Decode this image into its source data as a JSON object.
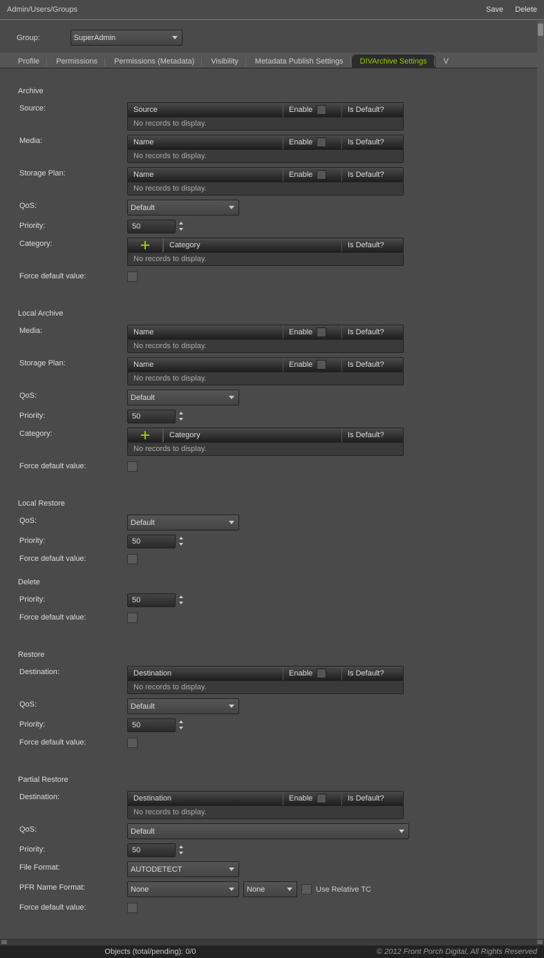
{
  "header": {
    "breadcrumb": "Admin/Users/Groups",
    "save": "Save",
    "delete": "Delete"
  },
  "group": {
    "label": "Group:",
    "value": "SuperAdmin"
  },
  "tabs": [
    "Profile",
    "Permissions",
    "Permissions (Metadata)",
    "Visibility",
    "Metadata Publish Settings",
    "DIVArchive Settings",
    "V"
  ],
  "active_tab": "DIVArchive Settings",
  "common": {
    "enable": "Enable",
    "isdefault": "Is Default?",
    "norec": "No records to display.",
    "qos": "Default",
    "priority": "50",
    "force": "Force default value:",
    "source": "Source",
    "name": "Name",
    "category": "Category",
    "dest": "Destination"
  },
  "sections": {
    "archive": {
      "title": "Archive",
      "l_source": "Source:",
      "l_media": "Media:",
      "l_sp": "Storage Plan:",
      "l_qos": "QoS:",
      "l_pri": "Priority:",
      "l_cat": "Category:"
    },
    "larchive": {
      "title": "Local Archive",
      "l_media": "Media:",
      "l_sp": "Storage Plan:",
      "l_qos": "QoS:",
      "l_pri": "Priority:",
      "l_cat": "Category:"
    },
    "lrestore": {
      "title": "Local Restore",
      "l_qos": "QoS:",
      "l_pri": "Priority:"
    },
    "delete": {
      "title": "Delete",
      "l_pri": "Priority:"
    },
    "restore": {
      "title": "Restore",
      "l_dest": "Destination:",
      "l_qos": "QoS:",
      "l_pri": "Priority:"
    },
    "prestore": {
      "title": "Partial Restore",
      "l_dest": "Destination:",
      "l_qos": "QoS:",
      "l_pri": "Priority:",
      "l_ff": "File Format:",
      "l_pfr": "PFR Name Format:",
      "ff": "AUTODETECT",
      "pfr1": "None",
      "pfr2": "None",
      "rel": "Use Relative TC"
    }
  },
  "footer": {
    "status": "Objects (total/pending): 0/0",
    "copy": "© 2012 Front Porch Digital, All Rights Reserved"
  }
}
